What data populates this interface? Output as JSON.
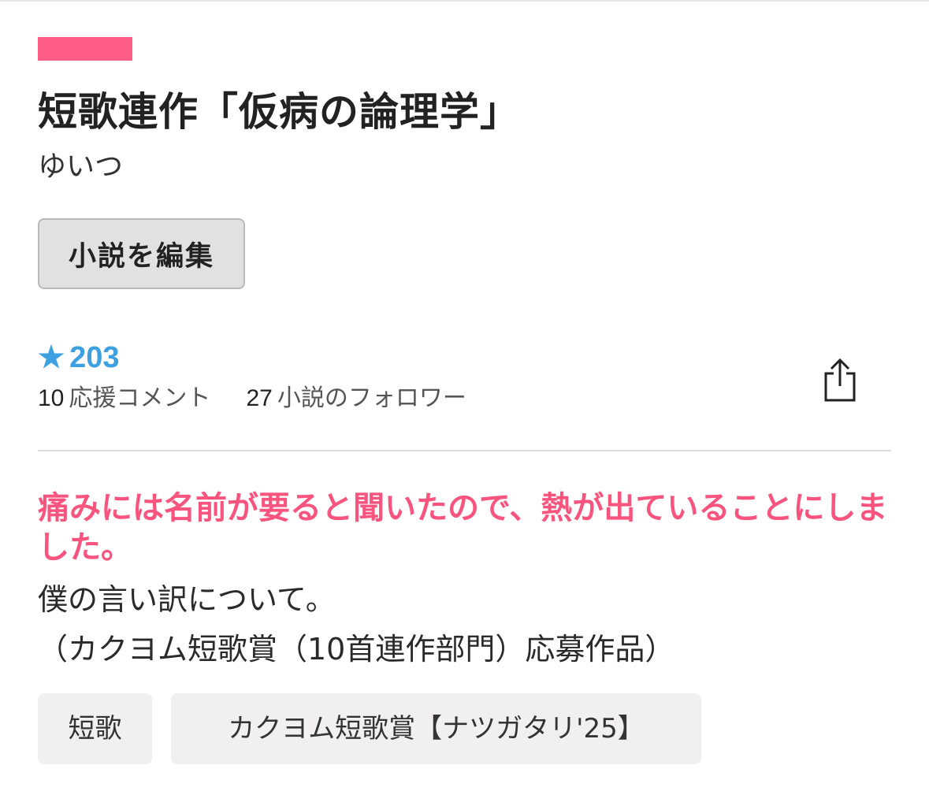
{
  "work": {
    "title": "短歌連作「仮病の論理学」",
    "author": "ゆいつ",
    "edit_button_label": "小説を編集"
  },
  "stats": {
    "star_icon": "★",
    "stars": "203",
    "comments_count": "10",
    "comments_label": "応援コメント",
    "followers_count": "27",
    "followers_label": "小説のフォロワー",
    "share_icon": "share-icon"
  },
  "catchphrase": "痛みには名前が要ると聞いたので、熱が出ていることにしました。",
  "introduction": {
    "line1": "僕の言い訳について。",
    "line2": "（カクヨム短歌賞（10首連作部門）応募作品）"
  },
  "tags": [
    {
      "label": "短歌"
    },
    {
      "label": "カクヨム短歌賞【ナツガタリ'25】"
    }
  ],
  "colors": {
    "accent": "#ff5c86",
    "catchphrase": "#f8547e",
    "star": "#3da0e0"
  }
}
